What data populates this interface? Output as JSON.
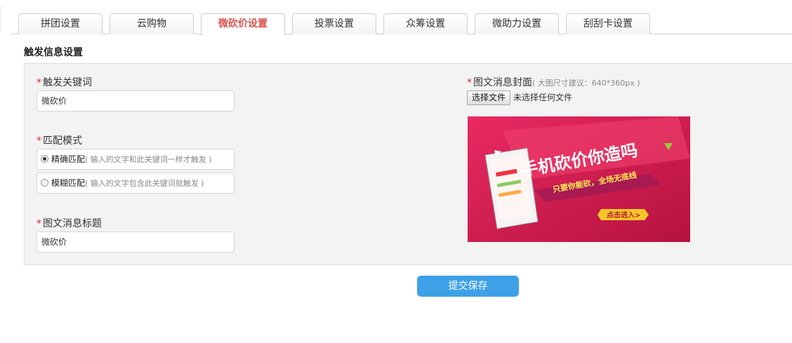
{
  "tabs": [
    {
      "label": "拼团设置"
    },
    {
      "label": "云购物"
    },
    {
      "label": "微砍价设置",
      "active": true
    },
    {
      "label": "投票设置"
    },
    {
      "label": "众筹设置"
    },
    {
      "label": "微助力设置"
    },
    {
      "label": "刮刮卡设置"
    }
  ],
  "section": {
    "title": "触发信息设置"
  },
  "form": {
    "required_mark": "*",
    "keyword": {
      "label": "触发关键词",
      "value": "微砍价"
    },
    "match_mode": {
      "label": "匹配模式",
      "options": [
        {
          "label": "精确匹配",
          "hint": "( 输入的文字和此关键词一样才触发 )",
          "selected": true
        },
        {
          "label": "模糊匹配",
          "hint": "( 输入的文字包含此关键词就触发 )",
          "selected": false
        }
      ]
    },
    "news_title": {
      "label": "图文消息标题",
      "value": "微砍价"
    },
    "cover": {
      "label": "图文消息封面",
      "hint": "( 大图尺寸建议：640*360px )",
      "choose_button": "选择文件",
      "no_file_text": "未选择任何文件",
      "banner": {
        "headline": "手机砍价你造吗",
        "subline": "只要你能砍，全场无底线",
        "cta": "点击进入>"
      }
    }
  },
  "submit": {
    "label": "提交保存"
  },
  "colors": {
    "accent": "#3ea1e8",
    "active_tab": "#d9534f",
    "required": "#e02020",
    "banner_bg": "#d81e5b"
  }
}
